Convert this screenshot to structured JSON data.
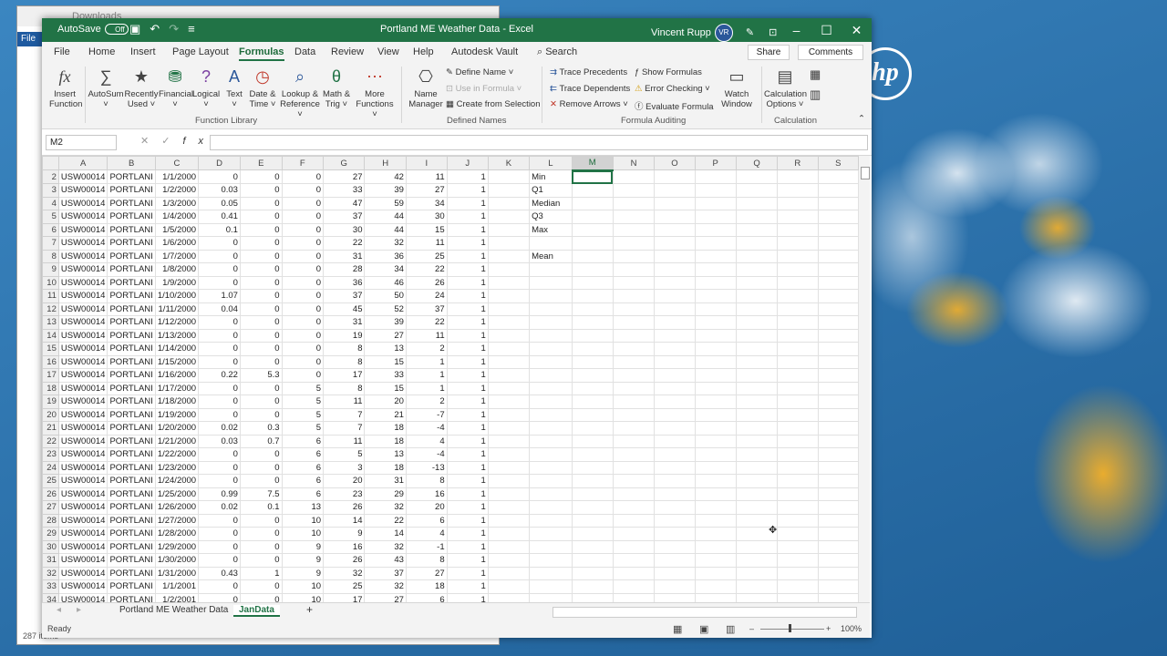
{
  "background": {
    "explorer_title": "Downloads",
    "file_tab": "File",
    "status": "287 items",
    "hp_logo": "hp"
  },
  "title_bar": {
    "autosave": "AutoSave",
    "autosave_state": "Off",
    "title": "Portland ME Weather Data  -  Excel",
    "user": "Vincent Rupp",
    "initials": "VR"
  },
  "menu": {
    "tabs": [
      "File",
      "Home",
      "Insert",
      "Page Layout",
      "Formulas",
      "Data",
      "Review",
      "View",
      "Help",
      "Autodesk Vault"
    ],
    "active": "Formulas",
    "search": "Search",
    "share": "Share",
    "comments": "Comments"
  },
  "ribbon": {
    "insert_function": [
      "Insert",
      "Function"
    ],
    "autosum": [
      "AutoSum",
      "˅"
    ],
    "recently_used": [
      "Recently",
      "Used ˅"
    ],
    "financial": [
      "Financial",
      "˅"
    ],
    "logical": [
      "Logical",
      "˅"
    ],
    "text": [
      "Text",
      "˅"
    ],
    "date_time": [
      "Date &",
      "Time ˅"
    ],
    "lookup": [
      "Lookup &",
      "Reference ˅"
    ],
    "math": [
      "Math &",
      "Trig ˅"
    ],
    "more": [
      "More",
      "Functions ˅"
    ],
    "function_library": "Function Library",
    "name_manager": [
      "Name",
      "Manager"
    ],
    "define_name": "Define Name  ˅",
    "use_in_formula": "Use in Formula ˅",
    "create_from_selection": "Create from Selection",
    "defined_names": "Defined Names",
    "trace_precedents": "Trace Precedents",
    "trace_dependents": "Trace Dependents",
    "remove_arrows": "Remove Arrows  ˅",
    "show_formulas": "Show Formulas",
    "error_checking": "Error Checking  ˅",
    "evaluate_formula": "Evaluate Formula",
    "watch_window": [
      "Watch",
      "Window"
    ],
    "formula_auditing": "Formula Auditing",
    "calc_options": [
      "Calculation",
      "Options ˅"
    ],
    "calculation": "Calculation"
  },
  "formula_bar": {
    "name_box": "M2",
    "fx": "fx",
    "value": ""
  },
  "columns": [
    "A",
    "B",
    "C",
    "D",
    "E",
    "F",
    "G",
    "H",
    "I",
    "J",
    "K",
    "L",
    "M",
    "N",
    "O",
    "P",
    "Q",
    "R",
    "S"
  ],
  "rows": [
    [
      "2",
      "USW00014",
      "PORTLANI",
      "1/1/2000",
      "0",
      "0",
      "0",
      "27",
      "42",
      "11",
      "1",
      "",
      "Min"
    ],
    [
      "3",
      "USW00014",
      "PORTLANI",
      "1/2/2000",
      "0.03",
      "0",
      "0",
      "33",
      "39",
      "27",
      "1",
      "",
      "Q1"
    ],
    [
      "4",
      "USW00014",
      "PORTLANI",
      "1/3/2000",
      "0.05",
      "0",
      "0",
      "47",
      "59",
      "34",
      "1",
      "",
      "Median"
    ],
    [
      "5",
      "USW00014",
      "PORTLANI",
      "1/4/2000",
      "0.41",
      "0",
      "0",
      "37",
      "44",
      "30",
      "1",
      "",
      "Q3"
    ],
    [
      "6",
      "USW00014",
      "PORTLANI",
      "1/5/2000",
      "0.1",
      "0",
      "0",
      "30",
      "44",
      "15",
      "1",
      "",
      "Max"
    ],
    [
      "7",
      "USW00014",
      "PORTLANI",
      "1/6/2000",
      "0",
      "0",
      "0",
      "22",
      "32",
      "11",
      "1",
      "",
      ""
    ],
    [
      "8",
      "USW00014",
      "PORTLANI",
      "1/7/2000",
      "0",
      "0",
      "0",
      "31",
      "36",
      "25",
      "1",
      "",
      "Mean"
    ],
    [
      "9",
      "USW00014",
      "PORTLANI",
      "1/8/2000",
      "0",
      "0",
      "0",
      "28",
      "34",
      "22",
      "1",
      "",
      ""
    ],
    [
      "10",
      "USW00014",
      "PORTLANI",
      "1/9/2000",
      "0",
      "0",
      "0",
      "36",
      "46",
      "26",
      "1",
      "",
      ""
    ],
    [
      "11",
      "USW00014",
      "PORTLANI",
      "1/10/2000",
      "1.07",
      "0",
      "0",
      "37",
      "50",
      "24",
      "1",
      "",
      ""
    ],
    [
      "12",
      "USW00014",
      "PORTLANI",
      "1/11/2000",
      "0.04",
      "0",
      "0",
      "45",
      "52",
      "37",
      "1",
      "",
      ""
    ],
    [
      "13",
      "USW00014",
      "PORTLANI",
      "1/12/2000",
      "0",
      "0",
      "0",
      "31",
      "39",
      "22",
      "1",
      "",
      ""
    ],
    [
      "14",
      "USW00014",
      "PORTLANI",
      "1/13/2000",
      "0",
      "0",
      "0",
      "19",
      "27",
      "11",
      "1",
      "",
      ""
    ],
    [
      "15",
      "USW00014",
      "PORTLANI",
      "1/14/2000",
      "0",
      "0",
      "0",
      "8",
      "13",
      "2",
      "1",
      "",
      ""
    ],
    [
      "16",
      "USW00014",
      "PORTLANI",
      "1/15/2000",
      "0",
      "0",
      "0",
      "8",
      "15",
      "1",
      "1",
      "",
      ""
    ],
    [
      "17",
      "USW00014",
      "PORTLANI",
      "1/16/2000",
      "0.22",
      "5.3",
      "0",
      "17",
      "33",
      "1",
      "1",
      "",
      ""
    ],
    [
      "18",
      "USW00014",
      "PORTLANI",
      "1/17/2000",
      "0",
      "0",
      "5",
      "8",
      "15",
      "1",
      "1",
      "",
      ""
    ],
    [
      "19",
      "USW00014",
      "PORTLANI",
      "1/18/2000",
      "0",
      "0",
      "5",
      "11",
      "20",
      "2",
      "1",
      "",
      ""
    ],
    [
      "20",
      "USW00014",
      "PORTLANI",
      "1/19/2000",
      "0",
      "0",
      "5",
      "7",
      "21",
      "-7",
      "1",
      "",
      ""
    ],
    [
      "21",
      "USW00014",
      "PORTLANI",
      "1/20/2000",
      "0.02",
      "0.3",
      "5",
      "7",
      "18",
      "-4",
      "1",
      "",
      ""
    ],
    [
      "22",
      "USW00014",
      "PORTLANI",
      "1/21/2000",
      "0.03",
      "0.7",
      "6",
      "11",
      "18",
      "4",
      "1",
      "",
      ""
    ],
    [
      "23",
      "USW00014",
      "PORTLANI",
      "1/22/2000",
      "0",
      "0",
      "6",
      "5",
      "13",
      "-4",
      "1",
      "",
      ""
    ],
    [
      "24",
      "USW00014",
      "PORTLANI",
      "1/23/2000",
      "0",
      "0",
      "6",
      "3",
      "18",
      "-13",
      "1",
      "",
      ""
    ],
    [
      "25",
      "USW00014",
      "PORTLANI",
      "1/24/2000",
      "0",
      "0",
      "6",
      "20",
      "31",
      "8",
      "1",
      "",
      ""
    ],
    [
      "26",
      "USW00014",
      "PORTLANI",
      "1/25/2000",
      "0.99",
      "7.5",
      "6",
      "23",
      "29",
      "16",
      "1",
      "",
      ""
    ],
    [
      "27",
      "USW00014",
      "PORTLANI",
      "1/26/2000",
      "0.02",
      "0.1",
      "13",
      "26",
      "32",
      "20",
      "1",
      "",
      ""
    ],
    [
      "28",
      "USW00014",
      "PORTLANI",
      "1/27/2000",
      "0",
      "0",
      "10",
      "14",
      "22",
      "6",
      "1",
      "",
      ""
    ],
    [
      "29",
      "USW00014",
      "PORTLANI",
      "1/28/2000",
      "0",
      "0",
      "10",
      "9",
      "14",
      "4",
      "1",
      "",
      ""
    ],
    [
      "30",
      "USW00014",
      "PORTLANI",
      "1/29/2000",
      "0",
      "0",
      "9",
      "16",
      "32",
      "-1",
      "1",
      "",
      ""
    ],
    [
      "31",
      "USW00014",
      "PORTLANI",
      "1/30/2000",
      "0",
      "0",
      "9",
      "26",
      "43",
      "8",
      "1",
      "",
      ""
    ],
    [
      "32",
      "USW00014",
      "PORTLANI",
      "1/31/2000",
      "0.43",
      "1",
      "9",
      "32",
      "37",
      "27",
      "1",
      "",
      ""
    ],
    [
      "33",
      "USW00014",
      "PORTLANI",
      "1/1/2001",
      "0",
      "0",
      "10",
      "25",
      "32",
      "18",
      "1",
      "",
      ""
    ],
    [
      "34",
      "USW00014",
      "PORTLANI",
      "1/2/2001",
      "0",
      "0",
      "10",
      "17",
      "27",
      "6",
      "1",
      "",
      ""
    ]
  ],
  "sheets": {
    "tabs": [
      "Portland ME Weather Data",
      "JanData"
    ],
    "active": "JanData",
    "add": "+"
  },
  "status": {
    "ready": "Ready",
    "zoom": "100%"
  }
}
